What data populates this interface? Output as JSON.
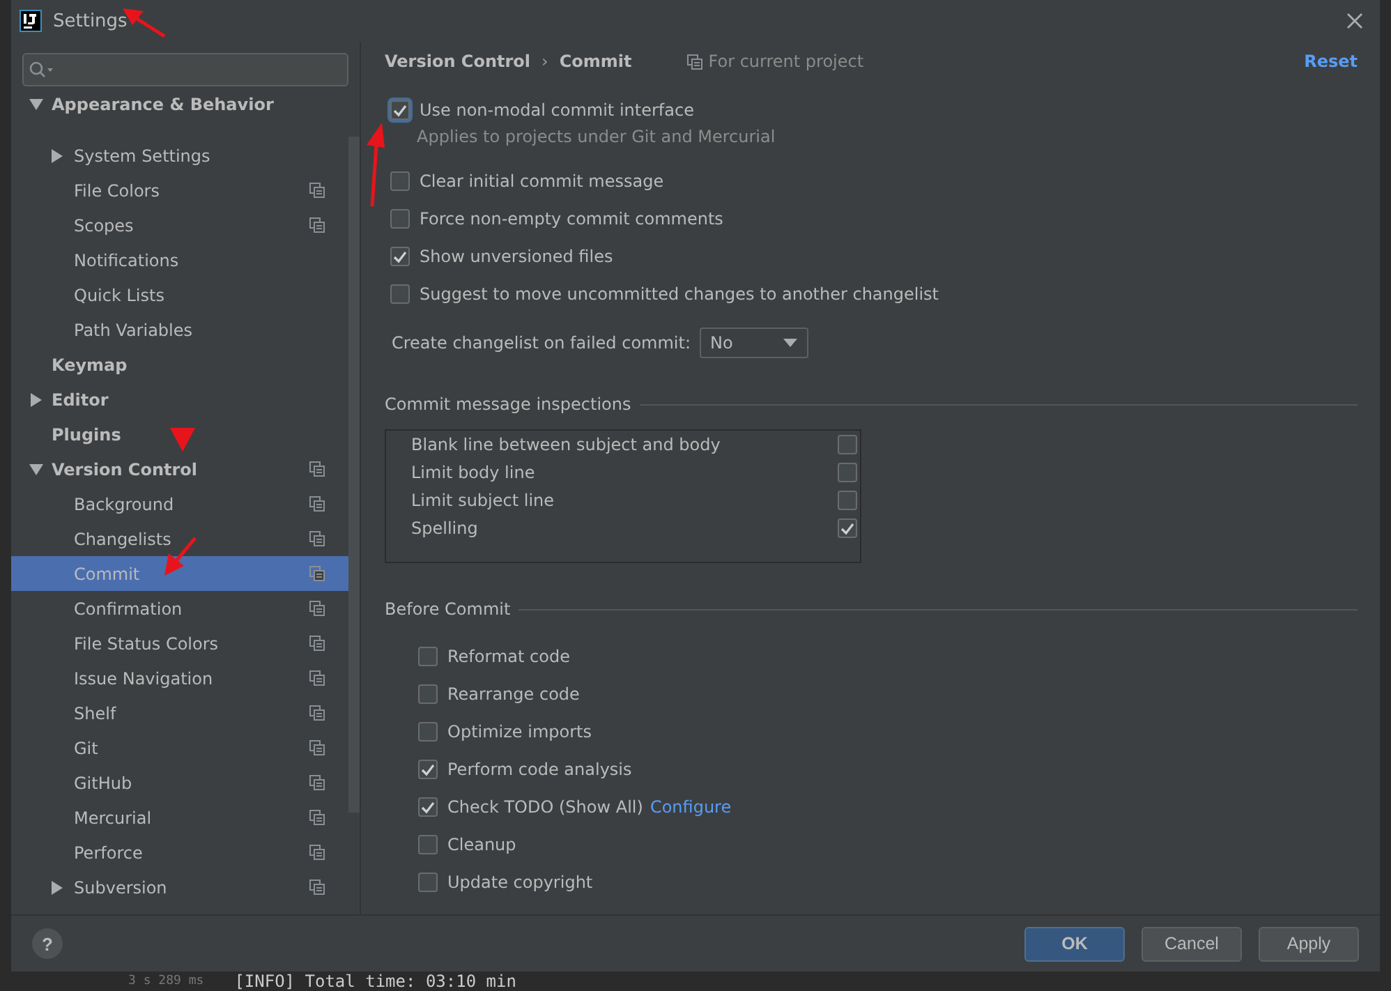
{
  "window": {
    "title": "Settings"
  },
  "sidebar": {
    "items": [
      {
        "label": "Appearance & Behavior",
        "expanded": true,
        "selected": false,
        "project_level": false,
        "children": [
          {
            "label": "System Settings",
            "expanded": false,
            "selected": false,
            "project_level": false
          },
          {
            "label": "File Colors",
            "selected": false,
            "project_level": true
          },
          {
            "label": "Scopes",
            "selected": false,
            "project_level": true
          },
          {
            "label": "Notifications",
            "selected": false,
            "project_level": false
          },
          {
            "label": "Quick Lists",
            "selected": false,
            "project_level": false
          },
          {
            "label": "Path Variables",
            "selected": false,
            "project_level": false
          }
        ]
      },
      {
        "label": "Keymap",
        "selected": false,
        "project_level": false
      },
      {
        "label": "Editor",
        "expanded": false,
        "selected": false,
        "project_level": false
      },
      {
        "label": "Plugins",
        "selected": false,
        "project_level": false
      },
      {
        "label": "Version Control",
        "expanded": true,
        "selected": false,
        "project_level": true,
        "children": [
          {
            "label": "Background",
            "selected": false,
            "project_level": true
          },
          {
            "label": "Changelists",
            "selected": false,
            "project_level": true
          },
          {
            "label": "Commit",
            "selected": true,
            "project_level": true
          },
          {
            "label": "Confirmation",
            "selected": false,
            "project_level": true
          },
          {
            "label": "File Status Colors",
            "selected": false,
            "project_level": true
          },
          {
            "label": "Issue Navigation",
            "selected": false,
            "project_level": true
          },
          {
            "label": "Shelf",
            "selected": false,
            "project_level": true
          },
          {
            "label": "Git",
            "selected": false,
            "project_level": true
          },
          {
            "label": "GitHub",
            "selected": false,
            "project_level": true
          },
          {
            "label": "Mercurial",
            "selected": false,
            "project_level": true
          },
          {
            "label": "Perforce",
            "selected": false,
            "project_level": true
          },
          {
            "label": "Subversion",
            "expanded": false,
            "selected": false,
            "project_level": true
          }
        ]
      }
    ]
  },
  "breadcrumb": {
    "parent": "Version Control",
    "separator": "›",
    "current": "Commit",
    "scope": "For current project",
    "reset": "Reset"
  },
  "options": [
    {
      "label": "Use non-modal commit interface",
      "checked": true,
      "focused": true,
      "hint": "Applies to projects under Git and Mercurial"
    },
    {
      "label": "Clear initial commit message",
      "checked": false,
      "focused": false
    },
    {
      "label": "Force non-empty commit comments",
      "checked": false,
      "focused": false
    },
    {
      "label": "Show unversioned files",
      "checked": true,
      "focused": false
    },
    {
      "label": "Suggest to move uncommitted changes to another changelist",
      "checked": false,
      "focused": false
    }
  ],
  "changelist_dropdown": {
    "label": "Create changelist on failed commit:",
    "value": "No"
  },
  "inspections": {
    "title": "Commit message inspections",
    "rows": [
      {
        "label": "Blank line between subject and body",
        "checked": false
      },
      {
        "label": "Limit body line",
        "checked": false
      },
      {
        "label": "Limit subject line",
        "checked": false
      },
      {
        "label": "Spelling",
        "checked": true
      }
    ]
  },
  "before_commit": {
    "title": "Before Commit",
    "items": [
      {
        "label": "Reformat code",
        "checked": false
      },
      {
        "label": "Rearrange code",
        "checked": false
      },
      {
        "label": "Optimize imports",
        "checked": false
      },
      {
        "label": "Perform code analysis",
        "checked": true
      },
      {
        "label": "Check TODO (Show All)",
        "checked": true,
        "link": "Configure"
      },
      {
        "label": "Cleanup",
        "checked": false
      },
      {
        "label": "Update copyright",
        "checked": false
      }
    ]
  },
  "footer": {
    "help": "?",
    "buttons": [
      {
        "label": "OK",
        "primary": true
      },
      {
        "label": "Cancel",
        "primary": false
      },
      {
        "label": "Apply",
        "primary": false
      }
    ]
  },
  "background_console": {
    "duration": "3 s 289 ms",
    "line": "[INFO] Total time:  03:10 min"
  }
}
